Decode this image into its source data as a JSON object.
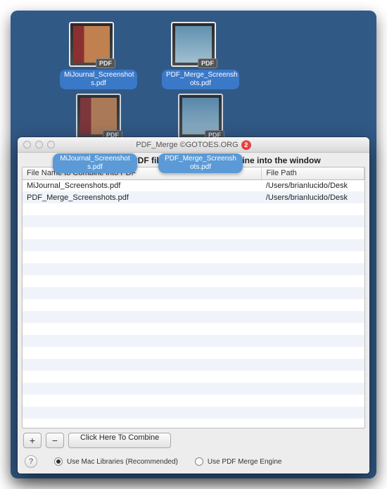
{
  "desktop": {
    "file1": {
      "name": "MiJournal_Screenshot\ns.pdf",
      "badge": "PDF"
    },
    "file2": {
      "name": "PDF_Merge_Screensh\nots.pdf",
      "badge": "PDF"
    },
    "drag1": {
      "name": "MiJournal_Screenshot\ns.pdf",
      "badge": "PDF"
    },
    "drag2": {
      "name": "PDF_Merge_Screensh\nots.pdf",
      "badge": "PDF"
    }
  },
  "window": {
    "title": "PDF_Merge ©GOTOES.ORG",
    "alert_count": "2",
    "instruction": "Please Drag the PDF files you want to combine into the window",
    "columns": {
      "name": "File Name to Combine into PDF",
      "path": "File Path"
    },
    "rows": [
      {
        "name": "MiJournal_Screenshots.pdf",
        "path": "/Users/brianlucido/Desk"
      },
      {
        "name": "PDF_Merge_Screenshots.pdf",
        "path": "/Users/brianlucido/Desk"
      }
    ],
    "buttons": {
      "add": "+",
      "remove": "−",
      "combine": "Click Here To Combine",
      "help": "?"
    },
    "options": {
      "mac": "Use Mac Libraries (Recommended)",
      "engine": "Use PDF Merge Engine",
      "selected": "mac"
    }
  }
}
